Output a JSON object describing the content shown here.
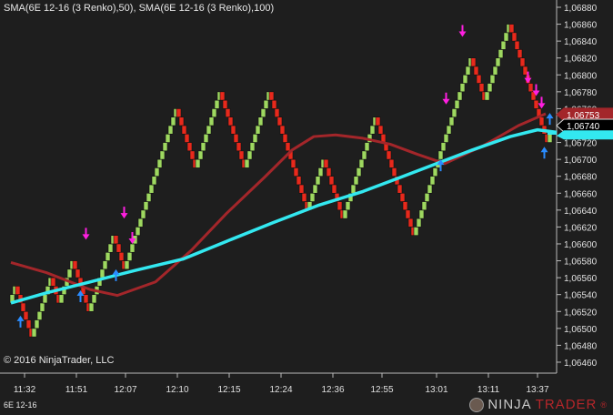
{
  "header": {
    "title": "SMA(6E 12-16 (3 Renko),50), SMA(6E 12-16 (3 Renko),100)"
  },
  "footer": {
    "copyright": "© 2016 NinjaTrader, LLC",
    "instrument": "6E 12-16",
    "logo_left": "NINJA",
    "logo_right": "TRADER",
    "logo_reg": "®"
  },
  "colors": {
    "up": "#9ed860",
    "down": "#e8291c",
    "sma50": "#a3262a",
    "sma100": "#33e8f0",
    "buy": "#2a8cff",
    "sell": "#ff1fe0",
    "bg": "#1e1e1e"
  },
  "chart_data": {
    "type": "renko",
    "title": "SMA(6E 12-16 (3 Renko),50), SMA(6E 12-16 (3 Renko),100)",
    "brick_size": 0.0001,
    "ylim": [
      1.0645,
      1.0689
    ],
    "y_ticks": [
      "1,06460",
      "1,06480",
      "1,06500",
      "1,06520",
      "1,06540",
      "1,06560",
      "1,06580",
      "1,06600",
      "1,06620",
      "1,06640",
      "1,06660",
      "1,06680",
      "1,06700",
      "1,06720",
      "1,06740",
      "1,06760",
      "1,06780",
      "1,06800",
      "1,06820",
      "1,06840",
      "1,06860",
      "1,06880"
    ],
    "y_tick_values": [
      1.0646,
      1.0648,
      1.065,
      1.0652,
      1.0654,
      1.0656,
      1.0658,
      1.066,
      1.0662,
      1.0664,
      1.0666,
      1.0668,
      1.067,
      1.0672,
      1.0674,
      1.0676,
      1.0678,
      1.068,
      1.0682,
      1.0684,
      1.0686,
      1.0688
    ],
    "x_ticks": [
      {
        "label": "11:32",
        "bar": 5
      },
      {
        "label": "11:51",
        "bar": 24
      },
      {
        "label": "12:07",
        "bar": 42
      },
      {
        "label": "12:10",
        "bar": 61
      },
      {
        "label": "12:15",
        "bar": 80
      },
      {
        "label": "12:24",
        "bar": 99
      },
      {
        "label": "12:36",
        "bar": 118
      },
      {
        "label": "12:55",
        "bar": 136
      },
      {
        "label": "13:01",
        "bar": 156
      },
      {
        "label": "13:11",
        "bar": 175
      },
      {
        "label": "13:37",
        "bar": 193
      }
    ],
    "renko_pivots": [
      1.0653,
      1.0655,
      1.0649,
      1.0656,
      1.0653,
      1.0658,
      1.0652,
      1.0661,
      1.0657,
      1.0676,
      1.0669,
      1.0678,
      1.0669,
      1.0678,
      1.0664,
      1.067,
      1.0663,
      1.0675,
      1.0661,
      1.0682,
      1.0677,
      1.0686,
      1.0672,
      1.0673
    ],
    "series": [
      {
        "name": "SMA(6E 12-16 (3 Renko),50)",
        "points": [
          [
            0,
            1.06578
          ],
          [
            13,
            1.06566
          ],
          [
            29,
            1.06546
          ],
          [
            39,
            1.06539
          ],
          [
            53,
            1.06555
          ],
          [
            66,
            1.06592
          ],
          [
            79,
            1.06636
          ],
          [
            93,
            1.06679
          ],
          [
            103,
            1.06711
          ],
          [
            111,
            1.06727
          ],
          [
            119,
            1.06729
          ],
          [
            129,
            1.06725
          ],
          [
            139,
            1.06718
          ],
          [
            149,
            1.06706
          ],
          [
            159,
            1.06695
          ],
          [
            173,
            1.06716
          ],
          [
            186,
            1.0674
          ],
          [
            196,
            1.06754
          ]
        ]
      },
      {
        "name": "SMA(6E 12-16 (3 Renko),100)",
        "points": [
          [
            0,
            1.0653
          ],
          [
            13,
            1.06542
          ],
          [
            29,
            1.06555
          ],
          [
            46,
            1.06569
          ],
          [
            63,
            1.06582
          ],
          [
            79,
            1.06603
          ],
          [
            96,
            1.06625
          ],
          [
            113,
            1.06646
          ],
          [
            129,
            1.06662
          ],
          [
            143,
            1.06679
          ],
          [
            156,
            1.06695
          ],
          [
            169,
            1.06711
          ],
          [
            183,
            1.06727
          ],
          [
            193,
            1.06735
          ],
          [
            200,
            1.06732
          ]
        ]
      }
    ],
    "signals": [
      {
        "type": "buy",
        "bar": 3,
        "price": 1.06515
      },
      {
        "type": "buy",
        "bar": 25,
        "price": 1.06545
      },
      {
        "type": "buy",
        "bar": 38,
        "price": 1.0657
      },
      {
        "type": "buy",
        "bar": 157,
        "price": 1.067
      },
      {
        "type": "buy",
        "bar": 195,
        "price": 1.06715
      },
      {
        "type": "buy",
        "bar": 197,
        "price": 1.06755
      },
      {
        "type": "sell",
        "bar": 27,
        "price": 1.06605
      },
      {
        "type": "sell",
        "bar": 41,
        "price": 1.0663
      },
      {
        "type": "sell",
        "bar": 44,
        "price": 1.066
      },
      {
        "type": "sell",
        "bar": 159,
        "price": 1.06765
      },
      {
        "type": "sell",
        "bar": 165,
        "price": 1.06845
      },
      {
        "type": "sell",
        "bar": 189,
        "price": 1.0679
      },
      {
        "type": "sell",
        "bar": 192,
        "price": 1.06775
      },
      {
        "type": "sell",
        "bar": 194,
        "price": 1.0676
      }
    ],
    "price_markers": [
      {
        "label": "1,06753",
        "value": 1.06753,
        "style": "sma50"
      },
      {
        "label": "1,06740",
        "value": 1.0674,
        "style": "last"
      }
    ],
    "grid": false
  }
}
